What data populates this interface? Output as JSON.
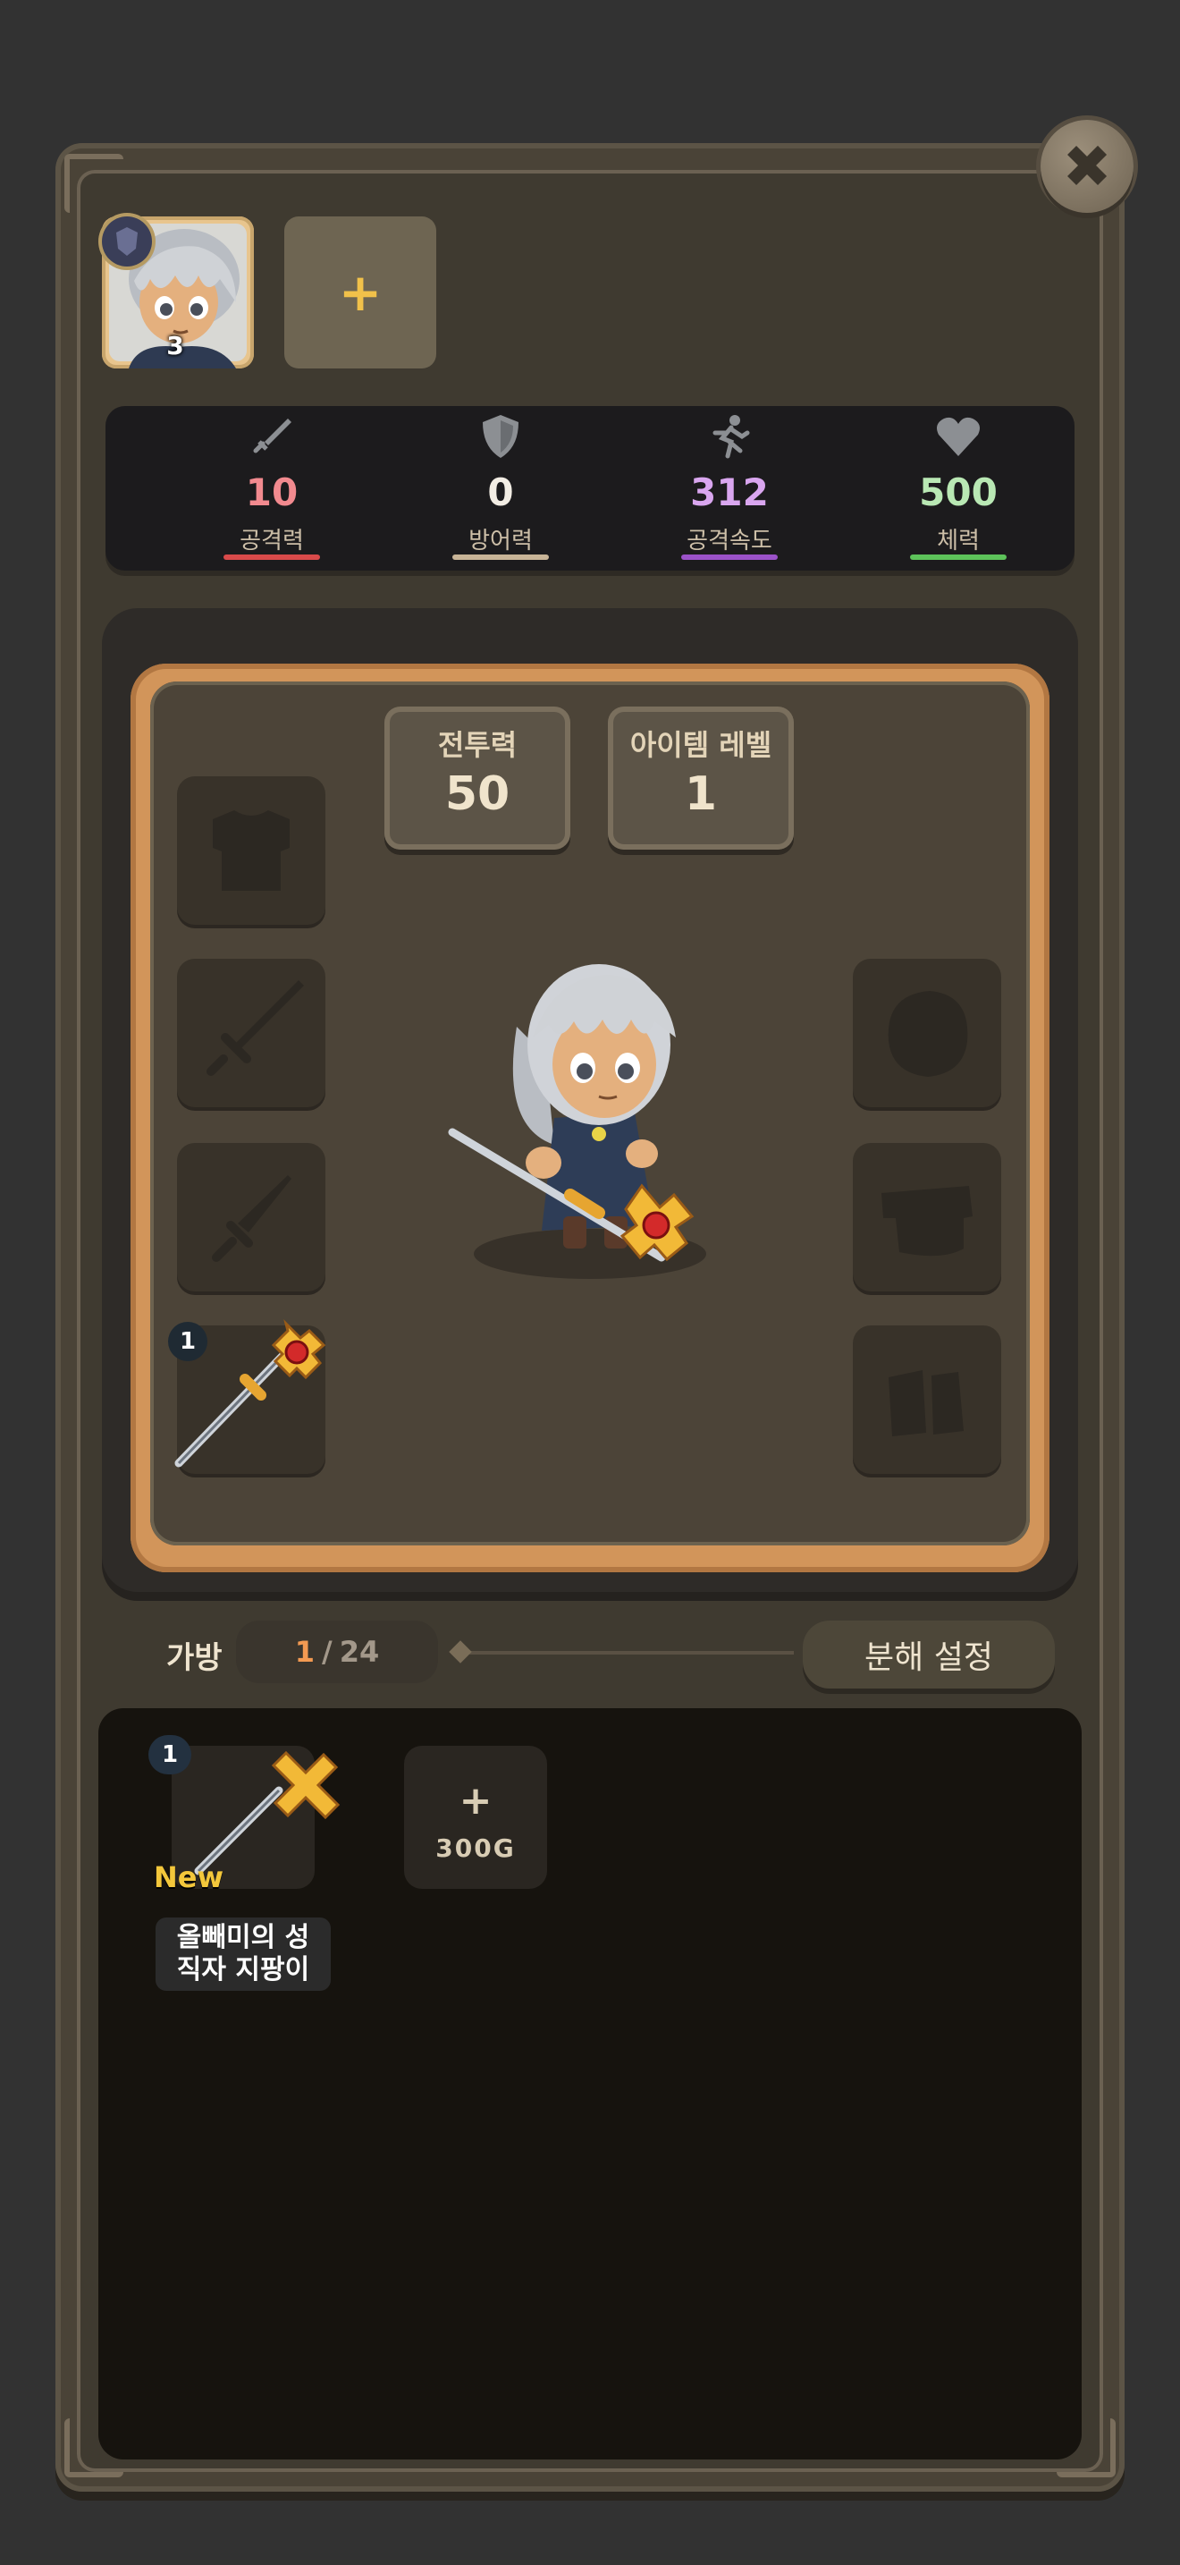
{
  "close": {
    "icon": "close-icon"
  },
  "hero": {
    "level": "3",
    "add_slot_label": "+"
  },
  "stats": [
    {
      "key": "attack",
      "icon": "sword-icon",
      "value": "10",
      "label": "공격력",
      "color": "#f28a8f",
      "bar_color": "#d94a4a"
    },
    {
      "key": "defense",
      "icon": "shield-icon",
      "value": "0",
      "label": "방어력",
      "color": "#f2ede4",
      "bar_color": "#c8b497"
    },
    {
      "key": "attack_speed",
      "icon": "running-icon",
      "value": "312",
      "label": "공격속도",
      "color": "#d9a6ef",
      "bar_color": "#9b52c9"
    },
    {
      "key": "hp",
      "icon": "heart-icon",
      "value": "500",
      "label": "체력",
      "color": "#b9e8b4",
      "bar_color": "#5dc35a"
    }
  ],
  "equipment": {
    "combat_power": {
      "title": "전투력",
      "value": "50"
    },
    "item_level": {
      "title": "아이템 레벨",
      "value": "1"
    },
    "weapon_slot_count": "1",
    "slots": [
      "armor-silhouette-icon",
      "sword-silhouette-icon",
      "dagger-silhouette-icon",
      "holy-staff-icon",
      "helmet-silhouette-icon",
      "gloves-silhouette-icon",
      "boots-silhouette-icon"
    ]
  },
  "bag": {
    "label": "가방",
    "current": "1",
    "separator": "/",
    "max": "24",
    "decompose_label": "분해 설정",
    "items": [
      {
        "count": "1",
        "badge": "New",
        "name_line1": "올빼미의 성",
        "name_line2": "직자 지팡이",
        "icon": "holy-staff-icon"
      }
    ],
    "expand": {
      "plus": "+",
      "price": "300G"
    }
  }
}
